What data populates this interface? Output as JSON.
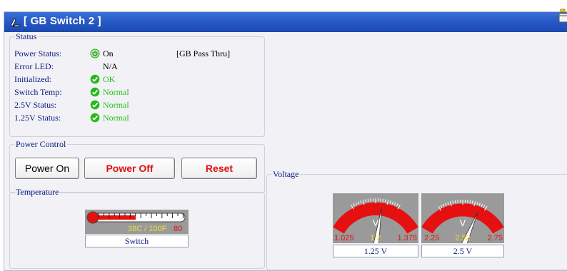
{
  "title": "[ GB Switch 2 ]",
  "status": {
    "legend": "Status",
    "rows": [
      {
        "label": "Power Status:",
        "value": "On",
        "extra": "[GB Pass Thru]"
      },
      {
        "label": "Error LED:",
        "value": "N/A"
      },
      {
        "label": "Initialized:",
        "value": "OK"
      },
      {
        "label": "Switch Temp:",
        "value": "Normal"
      },
      {
        "label": "2.5V Status:",
        "value": "Normal"
      },
      {
        "label": "1.25V Status:",
        "value": "Normal"
      }
    ]
  },
  "power_control": {
    "legend": "Power Control",
    "buttons": [
      "Power On",
      "Power Off",
      "Reset"
    ]
  },
  "temperature": {
    "legend": "Temperature",
    "reading": "38C / 100F",
    "max": "80",
    "label": "Switch",
    "level": 0.47
  },
  "voltage": {
    "legend": "Voltage",
    "gauges": [
      {
        "label": "1.25 V",
        "unit": "V",
        "min": "1.025",
        "center": "1.2",
        "max": "1.375",
        "value": 1.25,
        "min_num": 1.025,
        "max_num": 1.375
      },
      {
        "label": "2.5 V",
        "unit": "V",
        "min": "2.25",
        "center": "2.52",
        "max": "2.75",
        "value": 2.69,
        "min_num": 2.25,
        "max_num": 2.75
      }
    ]
  },
  "colors": {
    "title_bar": "#2456c4",
    "ok_green": "#27c415",
    "alert_red": "#e01010",
    "gauge_red": "#e61010"
  }
}
